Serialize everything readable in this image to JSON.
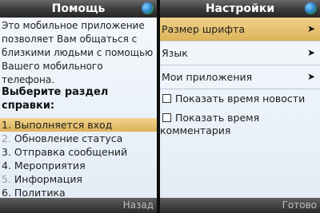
{
  "help_screen": {
    "title": "Помощь",
    "intro": "Это мобильное приложение позволяет Вам общаться с близкими людьми с помощью Вашего мобильного телефона.",
    "heading": "Выберите раздел справки:",
    "topics": [
      {
        "num": "1.",
        "label": "Выполняется вход",
        "selected": true
      },
      {
        "num": "2.",
        "label": "Обновление статуса"
      },
      {
        "num": "3.",
        "label": "Отправка сообщений"
      },
      {
        "num": "4.",
        "label": "Мероприятия"
      },
      {
        "num": "5.",
        "label": "Информация"
      },
      {
        "num": "6.",
        "label": "Политика"
      }
    ],
    "softkey_right": "Назад"
  },
  "settings_screen": {
    "title": "Настройки",
    "menu": [
      {
        "label": "Размер шрифта",
        "selected": true
      },
      {
        "label": "Язык"
      },
      {
        "label": "Мои приложения"
      }
    ],
    "checkboxes": [
      {
        "label": "Показать время новости",
        "checked": false
      },
      {
        "label": "Показать время комментария",
        "checked": false
      }
    ],
    "softkey_right": "Готово"
  }
}
